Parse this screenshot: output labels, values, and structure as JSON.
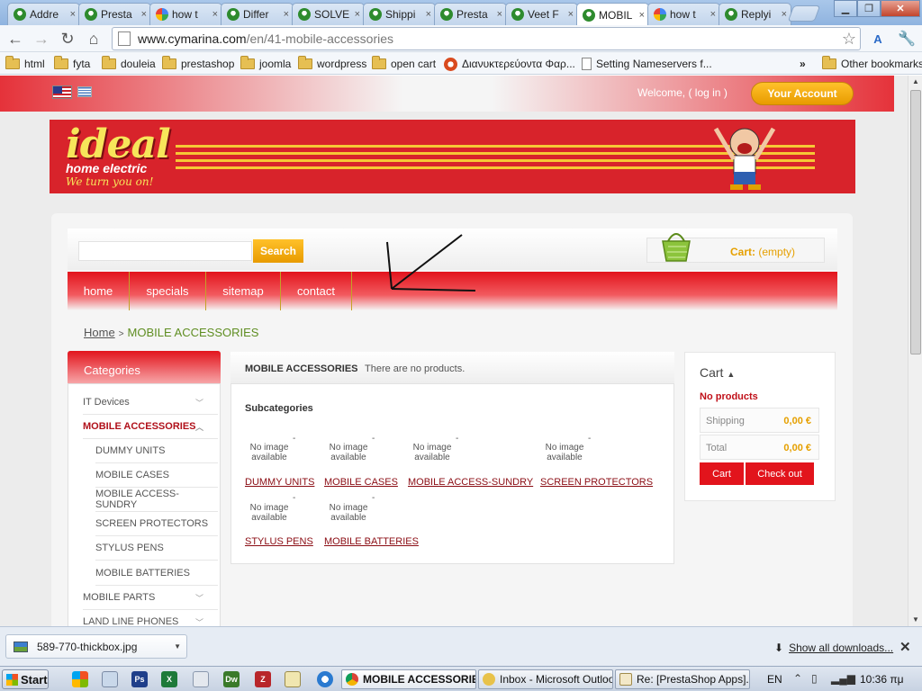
{
  "browser": {
    "tabs": [
      {
        "label": "Addre",
        "icon": "prestashop-icon"
      },
      {
        "label": "Presta",
        "icon": "prestashop-icon"
      },
      {
        "label": "how t",
        "icon": "google-icon"
      },
      {
        "label": "Differ",
        "icon": "prestashop-icon"
      },
      {
        "label": "SOLVE",
        "icon": "prestashop-icon"
      },
      {
        "label": "Shippi",
        "icon": "prestashop-icon"
      },
      {
        "label": "Presta",
        "icon": "prestashop-icon"
      },
      {
        "label": "Veet F",
        "icon": "prestashop-icon"
      },
      {
        "label": "MOBIL",
        "icon": "prestashop-icon",
        "active": true
      },
      {
        "label": "how t",
        "icon": "google-icon"
      },
      {
        "label": "Replyi",
        "icon": "prestashop-icon"
      }
    ],
    "tab_close_glyph": "×",
    "url_host": "www.cymarina.com",
    "url_path": "/en/41-mobile-accessories",
    "bookmarks": [
      "html",
      "fyta",
      "douleia",
      "prestashop",
      "joomla",
      "wordpress",
      "open cart",
      "Διανυκτερεύοντα Φαρ...",
      "Setting Nameservers f..."
    ],
    "bookmarks_overflow": "»",
    "other_bookmarks": "Other bookmarks"
  },
  "site": {
    "welcome": "Welcome, ( log in )",
    "account_button": "Your Account",
    "logo": {
      "brand": "ideal",
      "sub": "home electric",
      "tagline": "We turn you on!"
    },
    "search": {
      "placeholder": "",
      "button": "Search"
    },
    "cart_summary": {
      "label": "Cart:",
      "value": "(empty)"
    },
    "menu": [
      "home",
      "specials",
      "sitemap",
      "contact"
    ],
    "breadcrumb": {
      "home": "Home",
      "separator": ">",
      "current": "MOBILE ACCESSORIES"
    },
    "categories": {
      "title": "Categories",
      "items": [
        {
          "label": "IT Devices",
          "level": 0,
          "chevron": "﹀"
        },
        {
          "label": "MOBILE ACCESSORIES",
          "level": 0,
          "active": true,
          "chevron": "︿"
        },
        {
          "label": "DUMMY UNITS",
          "level": 1
        },
        {
          "label": "MOBILE CASES",
          "level": 1
        },
        {
          "label": "MOBILE ACCESS-SUNDRY",
          "level": 1
        },
        {
          "label": "SCREEN PROTECTORS",
          "level": 1
        },
        {
          "label": "STYLUS PENS",
          "level": 1
        },
        {
          "label": "MOBILE BATTERIES",
          "level": 1
        },
        {
          "label": "MOBILE PARTS",
          "level": 0,
          "chevron": "﹀"
        },
        {
          "label": "LAND LINE PHONES",
          "level": 0,
          "chevron": "﹀"
        }
      ]
    },
    "center": {
      "title": "MOBILE ACCESSORIES",
      "note": "There are no products.",
      "subcategories_title": "Subcategories",
      "no_image": "No image available",
      "dash": "-",
      "subcategories": [
        "DUMMY UNITS",
        "MOBILE CASES",
        "MOBILE ACCESS-SUNDRY",
        "SCREEN PROTECTORS",
        "STYLUS PENS",
        "MOBILE BATTERIES"
      ]
    },
    "cart_block": {
      "title": "Cart",
      "empty": "No products",
      "shipping_label": "Shipping",
      "shipping_value": "0,00 €",
      "total_label": "Total",
      "total_value": "0,00 €",
      "cart_button": "Cart",
      "checkout_button": "Check out"
    }
  },
  "downloads": {
    "file": "589-770-thickbox.jpg",
    "show_all": "Show all downloads..."
  },
  "taskbar": {
    "start": "Start",
    "tasks": [
      {
        "label": "MOBILE ACCESSORIE...",
        "active": true
      },
      {
        "label": "Inbox - Microsoft Outlook"
      },
      {
        "label": "Re: [PrestaShop Apps]..."
      }
    ],
    "lang": "EN",
    "clock": "10:36 πμ"
  },
  "colors": {
    "brand_red": "#e2141c",
    "accent_orange": "#e89b00",
    "link_dark_red": "#8b0d14",
    "breadcrumb_green": "#5f8e22"
  }
}
